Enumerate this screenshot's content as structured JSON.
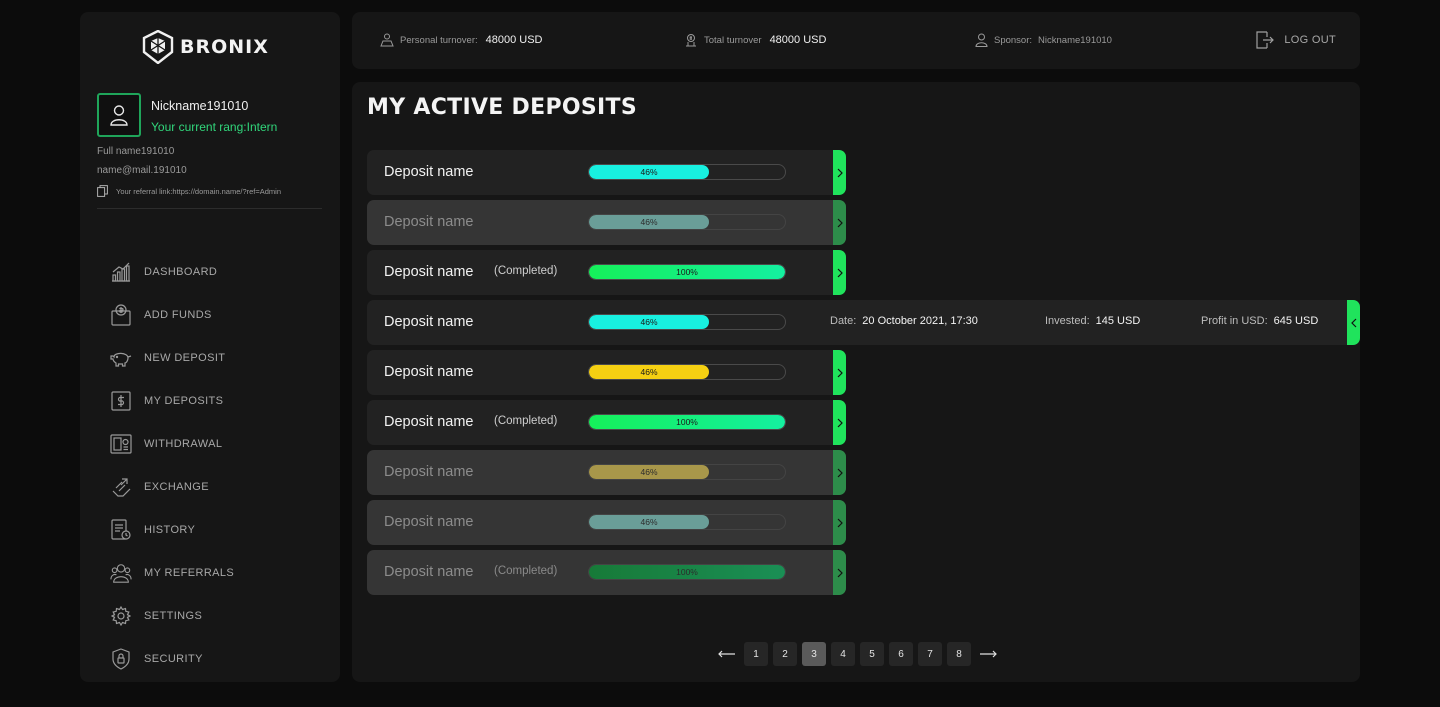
{
  "brand": {
    "name": "BRONIX"
  },
  "profile": {
    "nickname": "Nickname191010",
    "rang": "Your current rang:Intern",
    "full_name": "Full name191010",
    "email": "name@mail.191010",
    "referral": "Your referral link:https://domain.name/?ref=Admin"
  },
  "nav": [
    {
      "label": "DASHBOARD",
      "icon": "chart-bars-icon"
    },
    {
      "label": "ADD FUNDS",
      "icon": "wallet-dollar-icon"
    },
    {
      "label": "NEW DEPOSIT",
      "icon": "piggy-bank-icon"
    },
    {
      "label": "MY DEPOSITS",
      "icon": "dollar-square-icon"
    },
    {
      "label": "WITHDRAWAL",
      "icon": "cash-out-icon"
    },
    {
      "label": "EXCHANGE",
      "icon": "exchange-hand-icon"
    },
    {
      "label": "HISTORY",
      "icon": "document-history-icon"
    },
    {
      "label": "MY REFERRALS",
      "icon": "users-icon"
    },
    {
      "label": "SETTINGS",
      "icon": "gear-icon"
    },
    {
      "label": "SECURITY",
      "icon": "shield-lock-icon"
    }
  ],
  "topbar": {
    "personal_turnover_label": "Personal turnover:",
    "personal_turnover_value": "48000 USD",
    "total_turnover_label": "Total turnover",
    "total_turnover_value": "48000 USD",
    "sponsor_label": "Sponsor:",
    "sponsor_value": "Nickname191010",
    "logout_label": "LOG OUT"
  },
  "page": {
    "title": "MY ACTIVE DEPOSITS"
  },
  "colors": {
    "accent": "#20e35c",
    "cyan": "#18f0e0",
    "green_gradient_start": "#15f05a",
    "green_gradient_end": "#14f0a0",
    "yellow": "#f5d012"
  },
  "deposits": [
    {
      "name": "Deposit name",
      "status": "",
      "progress": 46,
      "label": "46%",
      "color": "#18f0e0",
      "dim": false,
      "expanded": false
    },
    {
      "name": "Deposit name",
      "status": "",
      "progress": 46,
      "label": "46%",
      "color": "#6a9e98",
      "dim": true,
      "expanded": false
    },
    {
      "name": "Deposit name",
      "status": "(Completed)",
      "progress": 100,
      "label": "100%",
      "color": "green",
      "dim": false,
      "expanded": false
    },
    {
      "name": "Deposit name",
      "status": "",
      "progress": 46,
      "label": "46%",
      "color": "#18f0e0",
      "dim": false,
      "expanded": true,
      "date_label": "Date:",
      "date_value": "20 October 2021, 17:30",
      "invested_label": "Invested:",
      "invested_value": "145 USD",
      "profit_label": "Profit in USD:",
      "profit_value": "645 USD"
    },
    {
      "name": "Deposit name",
      "status": "",
      "progress": 46,
      "label": "46%",
      "color": "#f5d012",
      "dim": false,
      "expanded": false
    },
    {
      "name": "Deposit name",
      "status": "(Completed)",
      "progress": 100,
      "label": "100%",
      "color": "green",
      "dim": false,
      "expanded": false
    },
    {
      "name": "Deposit name",
      "status": "",
      "progress": 46,
      "label": "46%",
      "color": "#a8974a",
      "dim": true,
      "expanded": false
    },
    {
      "name": "Deposit name",
      "status": "",
      "progress": 46,
      "label": "46%",
      "color": "#6a9e98",
      "dim": true,
      "expanded": false
    },
    {
      "name": "Deposit name",
      "status": "(Completed)",
      "progress": 100,
      "label": "100%",
      "color": "dimgreen",
      "dim": true,
      "expanded": false
    }
  ],
  "pagination": {
    "pages": [
      "1",
      "2",
      "3",
      "4",
      "5",
      "6",
      "7",
      "8"
    ],
    "current": "3"
  }
}
